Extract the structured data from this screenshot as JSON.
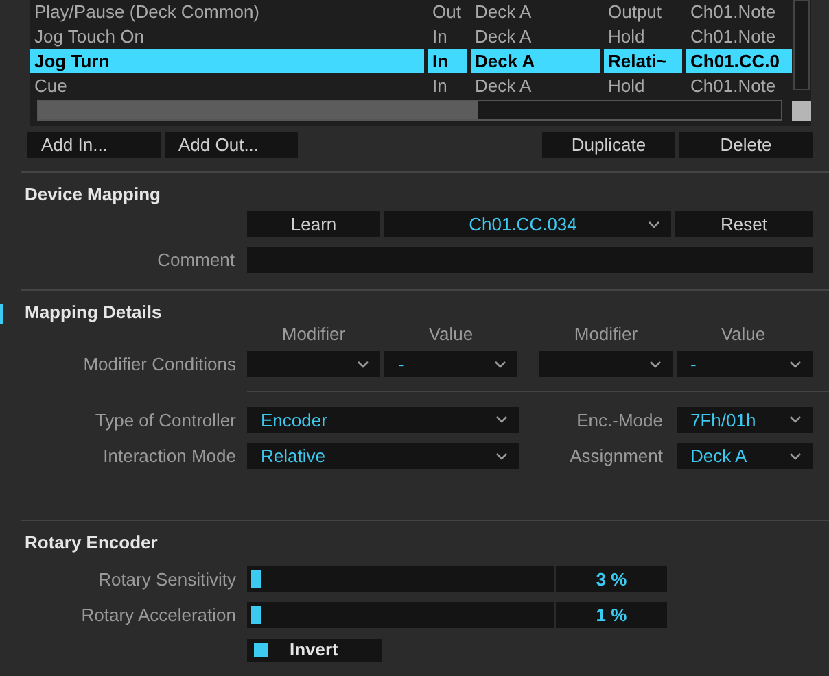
{
  "mapping_table": {
    "rows": [
      {
        "name": "Play/Pause (Deck Common)",
        "direction": "Out",
        "deck": "Deck A",
        "mode": "Output",
        "control": "Ch01.Note",
        "selected": false
      },
      {
        "name": "Jog Touch On",
        "direction": "In",
        "deck": "Deck A",
        "mode": "Hold",
        "control": "Ch01.Note",
        "selected": false
      },
      {
        "name": "Jog Turn",
        "direction": "In",
        "deck": "Deck A",
        "mode": "Relati~",
        "control": "Ch01.CC.0",
        "selected": true
      },
      {
        "name": "Cue",
        "direction": "In",
        "deck": "Deck A",
        "mode": "Hold",
        "control": "Ch01.Note",
        "selected": false
      }
    ]
  },
  "table_buttons": {
    "left": [
      "Add In...",
      "Add Out..."
    ],
    "right": [
      "Duplicate",
      "Delete"
    ]
  },
  "device_mapping": {
    "title": "Device Mapping",
    "learn": "Learn",
    "control_value": "Ch01.CC.034",
    "reset": "Reset",
    "comment_label": "Comment"
  },
  "mapping_details": {
    "title": "Mapping Details",
    "headers": [
      "Modifier",
      "Value",
      "Modifier",
      "Value"
    ],
    "conditions_label": "Modifier Conditions",
    "conditions": [
      {
        "kind": "blank"
      },
      {
        "kind": "value",
        "value": "-"
      },
      {
        "kind": "blank"
      },
      {
        "kind": "value",
        "value": "-"
      }
    ],
    "rows": [
      {
        "label": "Type of Controller",
        "value": "Encoder",
        "label2": "Enc.-Mode",
        "value2": "7Fh/01h"
      },
      {
        "label": "Interaction Mode",
        "value": "Relative",
        "label2": "Assignment",
        "value2": "Deck A"
      }
    ]
  },
  "rotary_encoder": {
    "title": "Rotary Encoder",
    "sliders": [
      {
        "label": "Rotary Sensitivity",
        "level": 0.03,
        "reading": "3 %"
      },
      {
        "label": "Rotary Acceleration",
        "level": 0.01,
        "reading": "1 %"
      }
    ],
    "invert": {
      "label": "Invert",
      "checked": true
    }
  }
}
